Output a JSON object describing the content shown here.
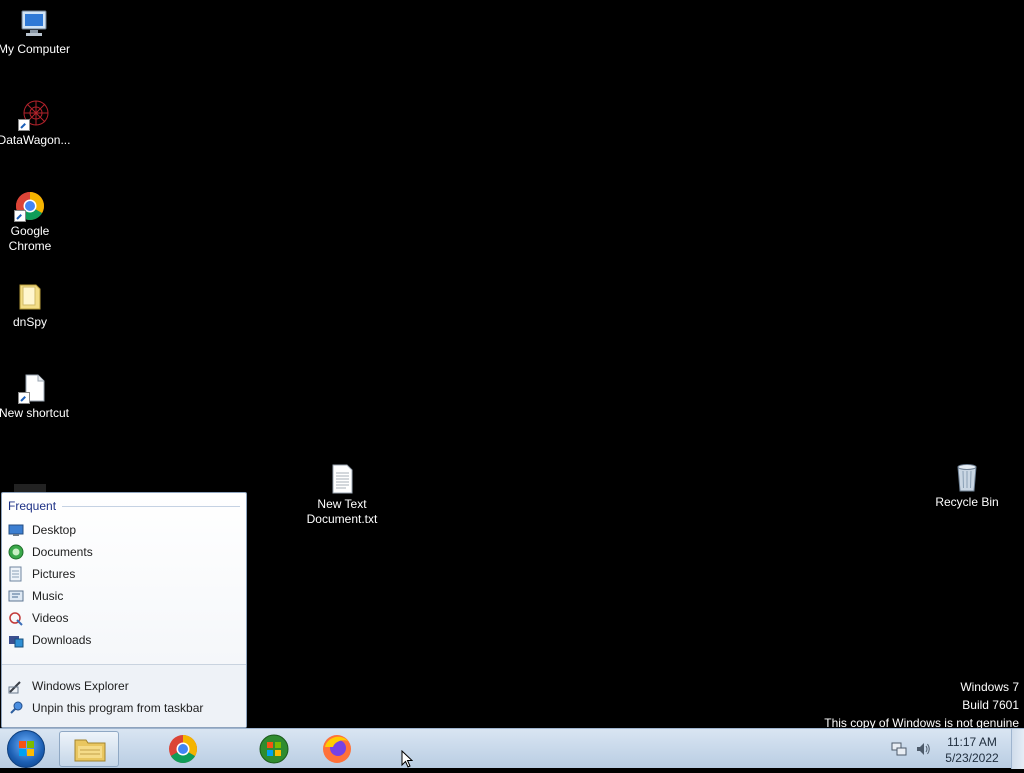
{
  "desktop": {
    "icons": [
      {
        "label": "My Computer",
        "icon": "computer-icon"
      },
      {
        "label": "DataWagon...",
        "icon": "datawagon-icon"
      },
      {
        "label": "Google",
        "label2": "Chrome",
        "icon": "chrome-icon"
      },
      {
        "label": "dnSpy",
        "icon": "folder-icon"
      },
      {
        "label": "New shortcut",
        "icon": "shortcut-file-icon"
      },
      {
        "label": "New Text",
        "label2": "Document.txt",
        "icon": "text-document-icon"
      },
      {
        "label": "Recycle Bin",
        "icon": "recycle-bin-icon"
      }
    ]
  },
  "jumplist": {
    "header": "Frequent",
    "items": [
      {
        "label": "Desktop",
        "icon": "desktop-folder-icon"
      },
      {
        "label": "Documents",
        "icon": "documents-icon"
      },
      {
        "label": "Pictures",
        "icon": "pictures-icon"
      },
      {
        "label": "Music",
        "icon": "music-icon"
      },
      {
        "label": "Videos",
        "icon": "videos-icon"
      },
      {
        "label": "Downloads",
        "icon": "downloads-icon"
      }
    ],
    "tasks": [
      {
        "label": "Windows Explorer",
        "icon": "windows-explorer-icon"
      },
      {
        "label": "Unpin this program from taskbar",
        "icon": "unpin-icon"
      }
    ]
  },
  "watermark": {
    "line1": "Windows 7",
    "line2": "Build 7601",
    "line3": "This copy of Windows is not genuine"
  },
  "taskbar": {
    "pinned": [
      "windows-explorer-icon",
      "chrome-icon",
      "windows-media-icon",
      "firefox-icon"
    ],
    "clock_time": "11:17 AM",
    "clock_date": "5/23/2022"
  },
  "colors": {
    "desktop_bg": "#000000",
    "taskbar_top": "#d9e5f2",
    "jumplist_header": "#1e3287"
  }
}
